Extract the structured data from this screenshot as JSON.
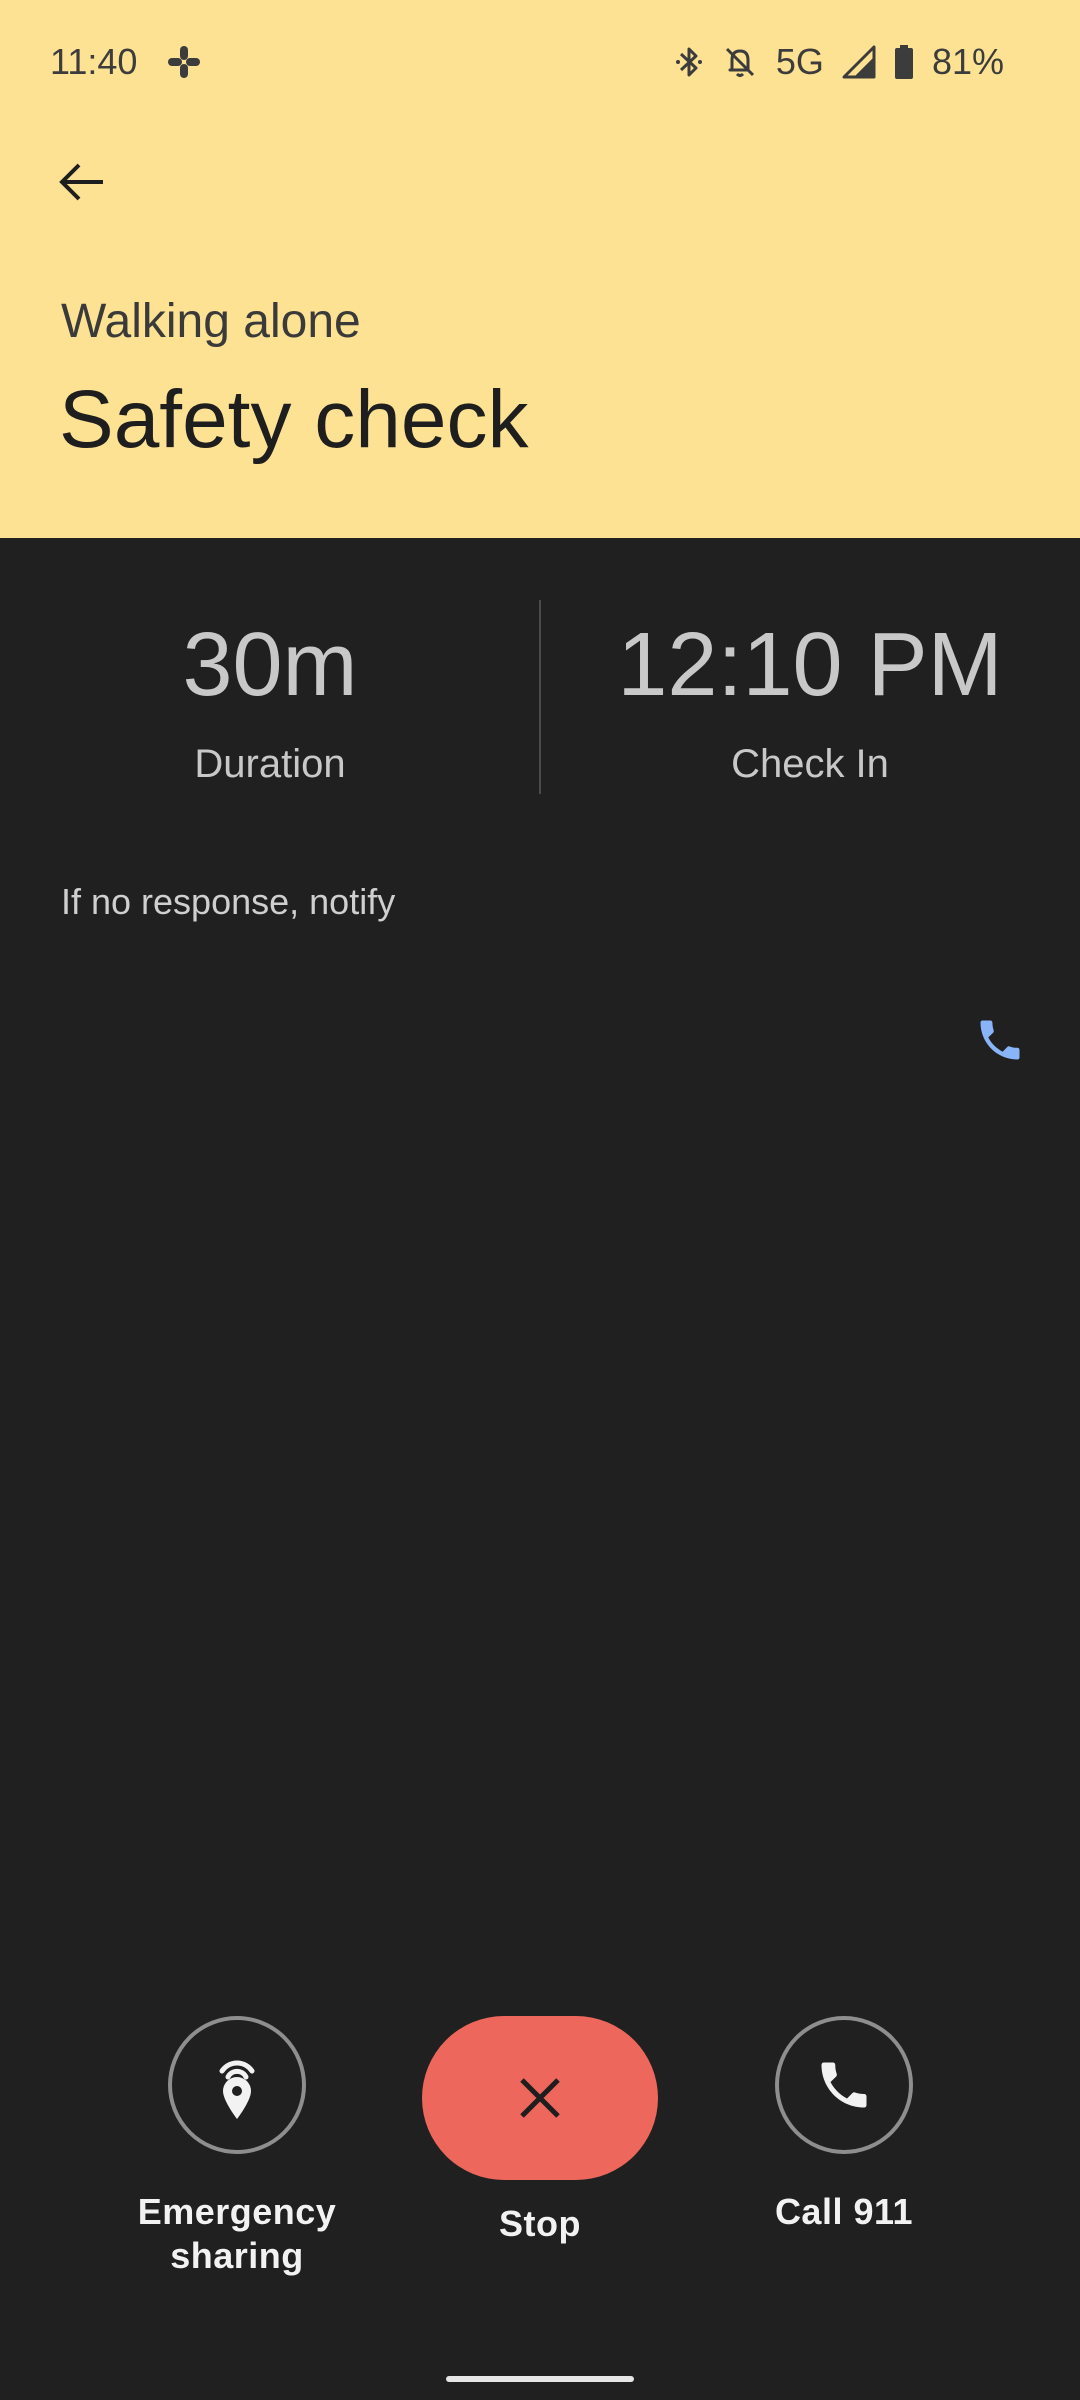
{
  "status_bar": {
    "time": "11:40",
    "network": "5G",
    "battery": "81%",
    "icons": [
      "slack-icon",
      "bluetooth-icon",
      "notifications-off-icon",
      "signal-icon",
      "battery-icon"
    ]
  },
  "header": {
    "back_icon": "arrow-back-icon",
    "subtitle": "Walking alone",
    "title": "Safety check",
    "background_color": "#fde293"
  },
  "stats": {
    "duration": {
      "value": "30m",
      "label": "Duration"
    },
    "check_in": {
      "value": "12:10 PM",
      "label": "Check In"
    }
  },
  "notify": {
    "label": "If no response, notify",
    "call_icon": "phone-icon",
    "call_icon_color": "#8ab4f8"
  },
  "actions": {
    "emergency_sharing": {
      "label": "Emergency sharing",
      "icon": "location-broadcast-icon"
    },
    "stop": {
      "label": "Stop",
      "icon": "close-icon",
      "color": "#ee675c"
    },
    "call_911": {
      "label": "Call 911",
      "icon": "phone-icon"
    }
  }
}
